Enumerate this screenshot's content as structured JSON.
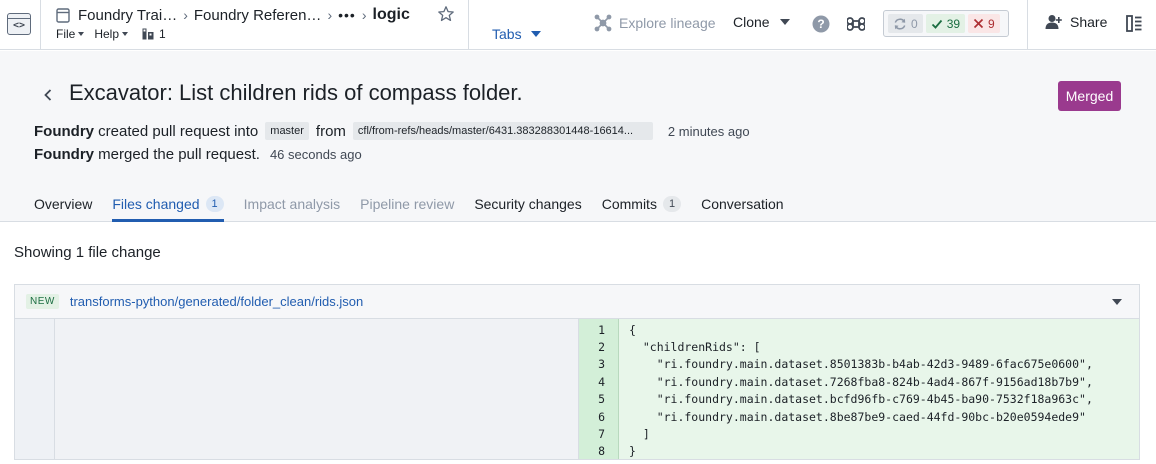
{
  "topbar": {
    "app_icon_glyph": "<>",
    "breadcrumbs": [
      "Foundry Trai…",
      "Foundry Referen…"
    ],
    "breadcrumb_more": "•••",
    "current": "logic",
    "menu": {
      "file": "File",
      "help": "Help",
      "branch_count": "1"
    },
    "tabs_label": "Tabs",
    "explore_lineage": "Explore lineage",
    "clone": "Clone",
    "checks": {
      "running": "0",
      "success": "39",
      "failed": "9"
    },
    "share": "Share"
  },
  "pr": {
    "title": "Excavator: List children rids of compass folder.",
    "status": "Merged",
    "line1": {
      "actor": "Foundry",
      "action": "created pull request into",
      "target_branch": "master",
      "from_word": "from",
      "source_branch": "cfl/from-refs/heads/master/6431.383288301448-16614...",
      "time": "2 minutes ago"
    },
    "line2": {
      "actor": "Foundry",
      "action": "merged the pull request.",
      "time": "46 seconds ago"
    },
    "tabs": [
      {
        "label": "Overview",
        "count": ""
      },
      {
        "label": "Files changed",
        "count": "1"
      },
      {
        "label": "Impact analysis",
        "count": ""
      },
      {
        "label": "Pipeline review",
        "count": ""
      },
      {
        "label": "Security changes",
        "count": ""
      },
      {
        "label": "Commits",
        "count": "1"
      },
      {
        "label": "Conversation",
        "count": ""
      }
    ]
  },
  "files": {
    "summary": "Showing 1 file change",
    "file": {
      "badge": "NEW",
      "path": "transforms-python/generated/folder_clean/rids.json",
      "lines": [
        {
          "num": "1",
          "code": "{"
        },
        {
          "num": "2",
          "code": "  \"childrenRids\": ["
        },
        {
          "num": "3",
          "code": "    \"ri.foundry.main.dataset.8501383b-b4ab-42d3-9489-6fac675e0600\","
        },
        {
          "num": "4",
          "code": "    \"ri.foundry.main.dataset.7268fba8-824b-4ad4-867f-9156ad18b7b9\","
        },
        {
          "num": "5",
          "code": "    \"ri.foundry.main.dataset.bcfd96fb-c769-4b45-ba90-7532f18a963c\","
        },
        {
          "num": "6",
          "code": "    \"ri.foundry.main.dataset.8be87be9-caed-44fd-90bc-b20e0594ede9\""
        },
        {
          "num": "7",
          "code": "  ]"
        },
        {
          "num": "8",
          "code": "}"
        }
      ]
    }
  },
  "colors": {
    "accent": "#215db0",
    "merged": "#9a3a8e",
    "success": "#1c6e42",
    "danger": "#ac2f33",
    "diff_added": "#e8f6ea"
  }
}
